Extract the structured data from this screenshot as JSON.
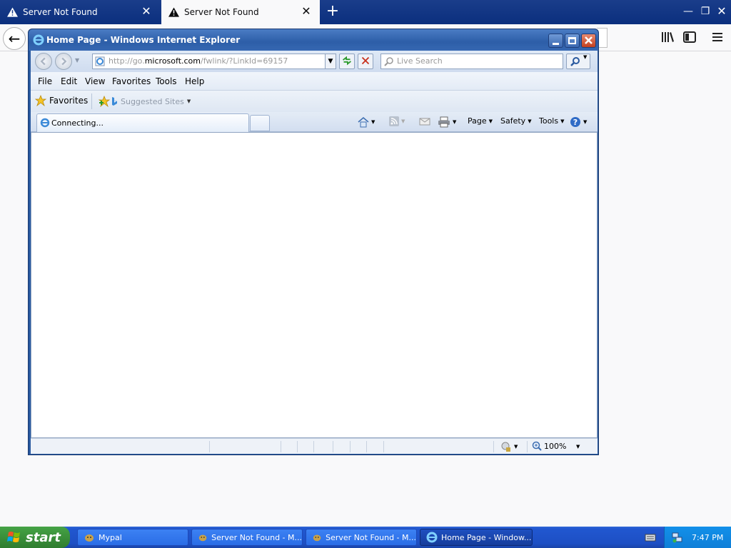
{
  "outer_browser": {
    "tabs": [
      {
        "label": "Server Not Found",
        "active": false
      },
      {
        "label": "Server Not Found",
        "active": true
      }
    ],
    "new_tab_symbol": "+",
    "close_symbol": "✕",
    "back_symbol": "←"
  },
  "ie": {
    "window_title": "Home Page - Windows Internet Explorer",
    "address": {
      "prefix": "http://go.",
      "domain": "microsoft.com",
      "suffix": "/fwlink/?LinkId=69157"
    },
    "search_placeholder": "Live Search",
    "menu": [
      "File",
      "Edit",
      "View",
      "Favorites",
      "Tools",
      "Help"
    ],
    "favorites_label": "Favorites",
    "suggested_sites_label": "Suggested Sites",
    "tab_label": "Connecting...",
    "commands": {
      "page": "Page",
      "safety": "Safety",
      "tools": "Tools"
    },
    "zoom": "100%"
  },
  "taskbar": {
    "start_label": "start",
    "tasks": [
      {
        "label": "Mypal",
        "active": false
      },
      {
        "label": "Server Not Found - M...",
        "active": false
      },
      {
        "label": "Server Not Found - M...",
        "active": false
      },
      {
        "label": "Home Page - Window...",
        "active": true
      }
    ],
    "clock": "7:47 PM"
  },
  "colors": {
    "xp_blue": "#2157d0",
    "start_green": "#3a8f3a",
    "ie_title_blue": "#2d5ea8",
    "close_red": "#c2401f"
  }
}
